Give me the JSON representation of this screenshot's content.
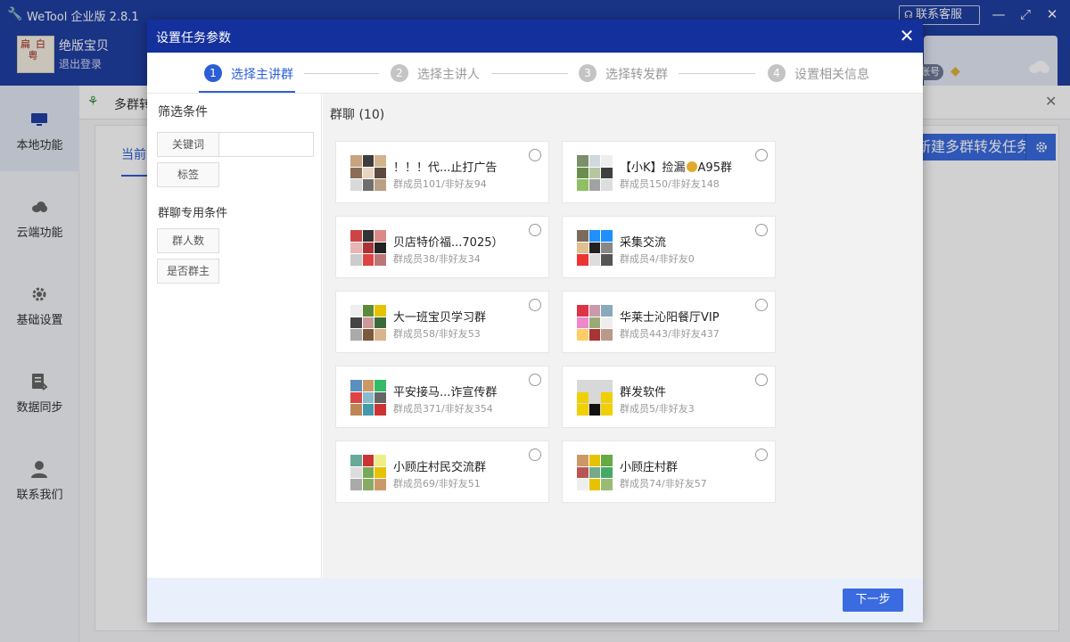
{
  "app": {
    "title": "WeTool 企业版 2.8.1",
    "support_label": "联系客服",
    "user": {
      "name": "绝版宝贝",
      "logout": "退出登录",
      "avatar_text": "扁白粤"
    },
    "account_badge": "账号"
  },
  "sidebar": {
    "items": [
      {
        "label": "本地功能",
        "icon": "monitor-icon"
      },
      {
        "label": "云端功能",
        "icon": "cloud-icon"
      },
      {
        "label": "基础设置",
        "icon": "gear-icon"
      },
      {
        "label": "数据同步",
        "icon": "sync-icon"
      },
      {
        "label": "联系我们",
        "icon": "user-icon"
      }
    ]
  },
  "main": {
    "crumb": "多群转",
    "tab_current": "当前",
    "create_task": "新建多群转发任务"
  },
  "modal": {
    "title": "设置任务参数",
    "steps": [
      {
        "num": "1",
        "label": "选择主讲群"
      },
      {
        "num": "2",
        "label": "选择主讲人"
      },
      {
        "num": "3",
        "label": "选择转发群"
      },
      {
        "num": "4",
        "label": "设置相关信息"
      }
    ],
    "filter": {
      "title": "筛选条件",
      "keyword_label": "关键词",
      "keyword_value": "",
      "tag_label": "标签",
      "group_title": "群聊专用条件",
      "member_count_label": "群人数",
      "is_owner_label": "是否群主"
    },
    "group_count_label": "群聊 (10)",
    "groups": [
      {
        "name": "！！！代...止打广告",
        "meta": "群成员101/非好友94"
      },
      {
        "name": "【小K】捡漏",
        "name_suffix": "A95群",
        "meta": "群成员150/非好友148",
        "has_medal": true
      },
      {
        "name": "贝店特价福...7025）",
        "meta": "群成员38/非好友34"
      },
      {
        "name": "采集交流",
        "meta": "群成员4/非好友0"
      },
      {
        "name": "大一班宝贝学习群",
        "meta": "群成员58/非好友53"
      },
      {
        "name": "华莱士沁阳餐厅VIP",
        "meta": "群成员443/非好友437"
      },
      {
        "name": "平安接马...诈宣传群",
        "meta": "群成员371/非好友354"
      },
      {
        "name": "群发软件",
        "meta": "群成员5/非好友3"
      },
      {
        "name": "小顾庄村民交流群",
        "meta": "群成员69/非好友51"
      },
      {
        "name": "小顾庄村群",
        "meta": "群成员74/非好友57"
      }
    ],
    "next_label": "下一步"
  },
  "colors": {
    "header_blue": "#1f3fa3",
    "modal_header": "#14309c",
    "accent": "#2b5fd8",
    "button": "#3a6be0"
  }
}
